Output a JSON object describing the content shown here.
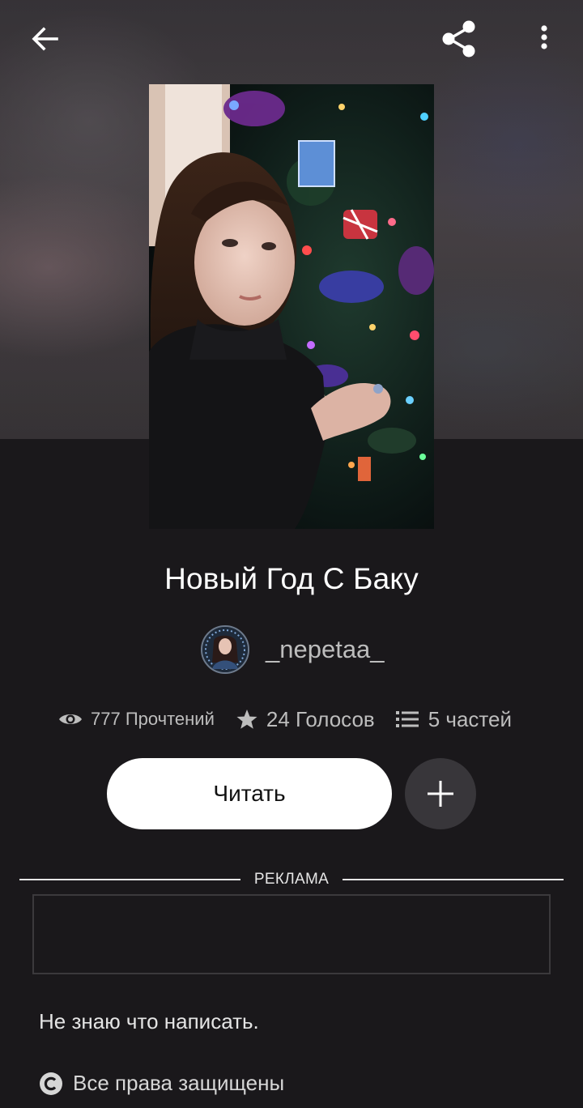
{
  "story": {
    "title": "Новый Год С Баку",
    "author": "_nepetaa_",
    "description": "Не знаю что написать.",
    "copyright": "Все права защищены"
  },
  "stats": {
    "reads": "777 Прочтений",
    "votes": "24 Голосов",
    "parts": "5 частей"
  },
  "actions": {
    "read_label": "Читать"
  },
  "ad": {
    "label": "РЕКЛАМА"
  },
  "icons": [
    "back-arrow-icon",
    "share-icon",
    "more-vertical-icon",
    "eye-icon",
    "star-icon",
    "list-icon",
    "plus-icon",
    "copyright-icon"
  ],
  "colors": {
    "background": "#1a181b",
    "primary_button": "#ffffff",
    "secondary_button": "#38363a",
    "muted_text": "#bdbdbd"
  }
}
